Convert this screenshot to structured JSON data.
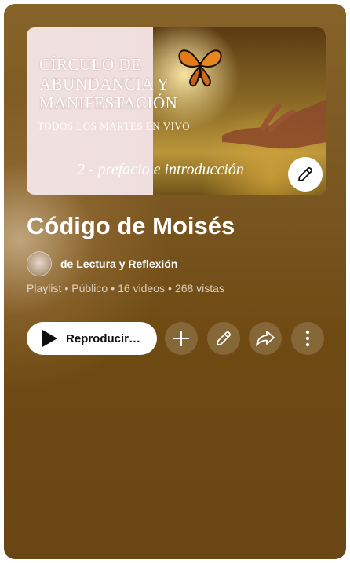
{
  "thumbnail": {
    "line1": "CÍRCULO DE",
    "line2": "ABUNDANCIA Y",
    "line3": "MANIFESTACIÓN",
    "subtitle": "TODOS LOS MARTES EN VIVO",
    "episode": "2 - prefacio e introducción",
    "edit_icon": "pencil-icon"
  },
  "playlist": {
    "title": "Código de Moisés",
    "channel": "de Lectura y Reflexión",
    "type": "Playlist",
    "privacy": "Público",
    "videos": "16 videos",
    "views": "268 vistas",
    "separator": "•"
  },
  "actions": {
    "play_label": "Reproducir…",
    "play_icon": "play-icon",
    "add_icon": "plus-icon",
    "edit_icon": "pencil-icon",
    "share_icon": "share-icon",
    "more_icon": "more-vert-icon"
  },
  "colors": {
    "panel_top": "#866328",
    "panel_bottom": "#6a4614",
    "button_bg": "#ffffff",
    "text_primary": "#ffffff"
  }
}
